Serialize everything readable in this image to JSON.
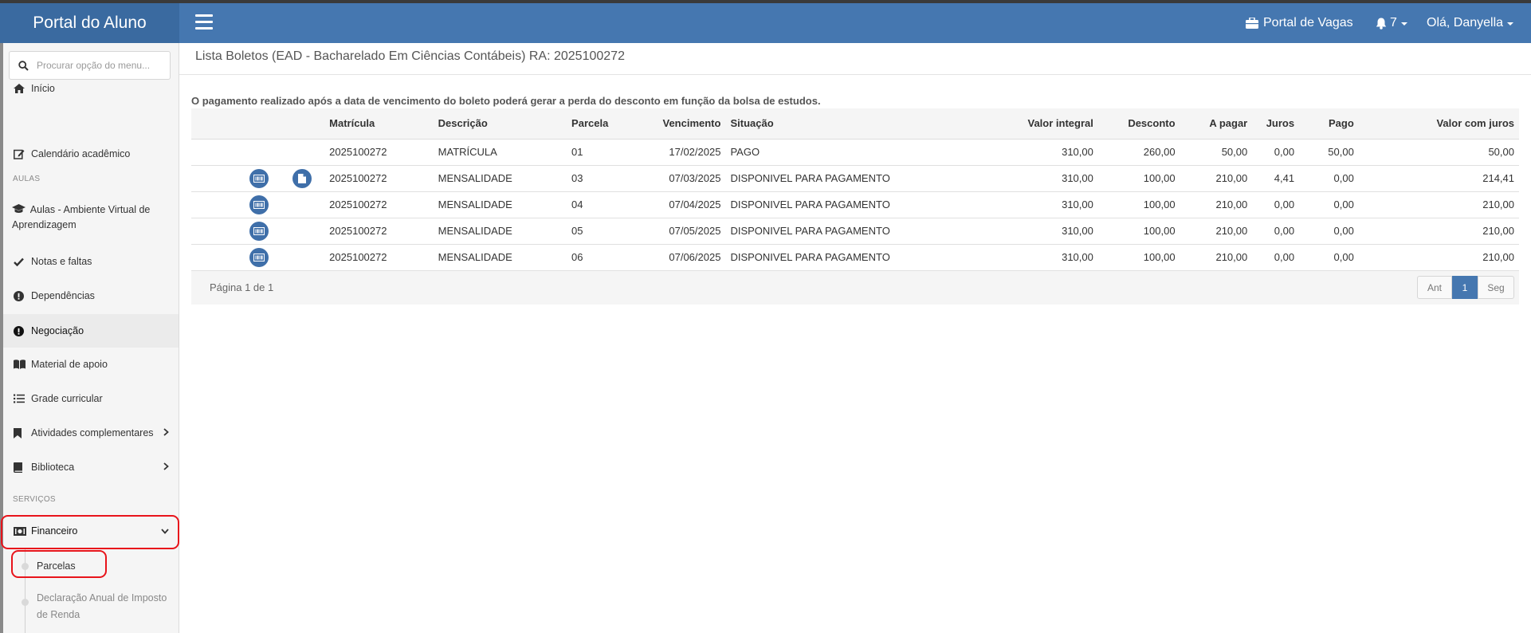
{
  "app": {
    "title": "Portal do Aluno"
  },
  "header": {
    "vagas_label": "Portal de Vagas",
    "notifications_count": "7",
    "user_greeting": "Olá, Danyella"
  },
  "sidebar": {
    "search_placeholder": "Procurar opção do menu...",
    "items": {
      "inicio": "Início",
      "calendario": "Calendário acadêmico",
      "aulas_section": "AULAS",
      "ava": "Aulas - Ambiente Virtual de Aprendizagem",
      "notas": "Notas e faltas",
      "dependencias": "Dependências",
      "negociacao": "Negociação",
      "material": "Material de apoio",
      "grade": "Grade curricular",
      "atividades": "Atividades complementares",
      "biblioteca": "Biblioteca",
      "servicos_section": "SERVIÇOS",
      "financeiro": "Financeiro",
      "parcelas": "Parcelas",
      "declaracao": "Declaração Anual de Imposto de Renda"
    }
  },
  "main": {
    "title": "Lista Boletos (EAD - Bacharelado Em Ciências Contábeis) RA: 2025100272",
    "notice": "O pagamento realizado após a data de vencimento do boleto poderá gerar a perda do desconto em função da bolsa de estudos.",
    "columns": {
      "matricula": "Matrícula",
      "descricao": "Descrição",
      "parcela": "Parcela",
      "vencimento": "Vencimento",
      "situacao": "Situação",
      "valor_integral": "Valor integral",
      "desconto": "Desconto",
      "a_pagar": "A pagar",
      "juros": "Juros",
      "pago": "Pago",
      "valor_com_juros": "Valor com juros"
    },
    "rows": [
      {
        "matricula": "2025100272",
        "descricao": "MATRÍCULA",
        "parcela": "01",
        "vencimento": "17/02/2025",
        "situacao": "PAGO",
        "valor_integral": "310,00",
        "desconto": "260,00",
        "a_pagar": "50,00",
        "juros": "0,00",
        "pago": "50,00",
        "valor_com_juros": "50,00"
      },
      {
        "matricula": "2025100272",
        "descricao": "MENSALIDADE",
        "parcela": "03",
        "vencimento": "07/03/2025",
        "situacao": "DISPONIVEL PARA PAGAMENTO",
        "valor_integral": "310,00",
        "desconto": "100,00",
        "a_pagar": "210,00",
        "juros": "4,41",
        "pago": "0,00",
        "valor_com_juros": "214,41"
      },
      {
        "matricula": "2025100272",
        "descricao": "MENSALIDADE",
        "parcela": "04",
        "vencimento": "07/04/2025",
        "situacao": "DISPONIVEL PARA PAGAMENTO",
        "valor_integral": "310,00",
        "desconto": "100,00",
        "a_pagar": "210,00",
        "juros": "0,00",
        "pago": "0,00",
        "valor_com_juros": "210,00"
      },
      {
        "matricula": "2025100272",
        "descricao": "MENSALIDADE",
        "parcela": "05",
        "vencimento": "07/05/2025",
        "situacao": "DISPONIVEL PARA PAGAMENTO",
        "valor_integral": "310,00",
        "desconto": "100,00",
        "a_pagar": "210,00",
        "juros": "0,00",
        "pago": "0,00",
        "valor_com_juros": "210,00"
      },
      {
        "matricula": "2025100272",
        "descricao": "MENSALIDADE",
        "parcela": "06",
        "vencimento": "07/06/2025",
        "situacao": "DISPONIVEL PARA PAGAMENTO",
        "valor_integral": "310,00",
        "desconto": "100,00",
        "a_pagar": "210,00",
        "juros": "0,00",
        "pago": "0,00",
        "valor_com_juros": "210,00"
      }
    ],
    "pagination": {
      "info": "Página 1 de 1",
      "prev": "Ant",
      "current": "1",
      "next": "Seg"
    }
  },
  "colors": {
    "header": "#4577b0",
    "brand": "#3a6aa0",
    "highlight": "#e8141b"
  }
}
